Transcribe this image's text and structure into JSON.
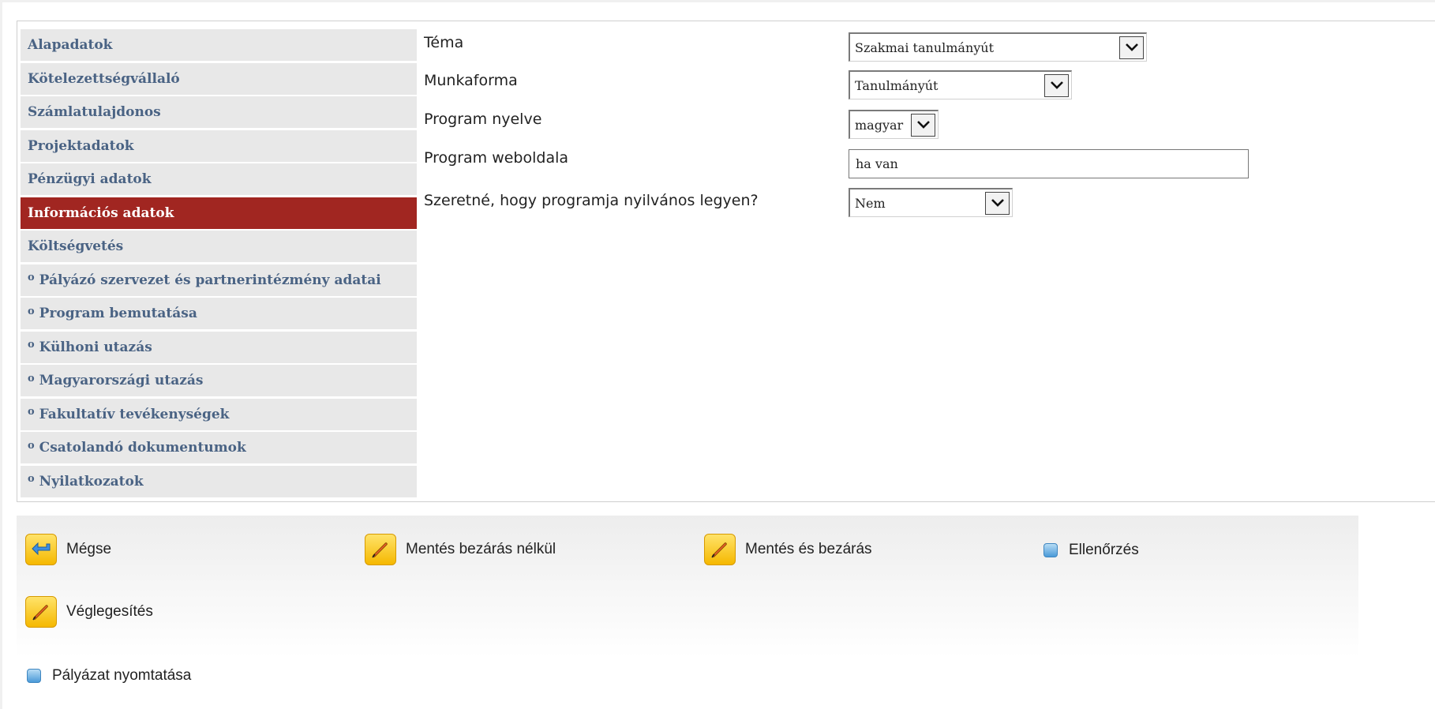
{
  "sidebar": {
    "items": [
      {
        "label": "Alapadatok",
        "bullet": ""
      },
      {
        "label": "Kötelezettségvállaló",
        "bullet": ""
      },
      {
        "label": "Számlatulajdonos",
        "bullet": ""
      },
      {
        "label": "Projektadatok",
        "bullet": ""
      },
      {
        "label": "Pénzügyi adatok",
        "bullet": ""
      },
      {
        "label": "Információs adatok",
        "bullet": ""
      },
      {
        "label": "Költségvetés",
        "bullet": ""
      },
      {
        "label": "Pályázó szervezet és partnerintézmény adatai",
        "bullet": "o"
      },
      {
        "label": "Program bemutatása",
        "bullet": "o"
      },
      {
        "label": "Külhoni utazás",
        "bullet": "o"
      },
      {
        "label": "Magyarországi utazás",
        "bullet": "o"
      },
      {
        "label": "Fakultatív tevékenységek",
        "bullet": "o"
      },
      {
        "label": "Csatolandó dokumentumok",
        "bullet": "o"
      },
      {
        "label": "Nyilatkozatok",
        "bullet": "o"
      }
    ],
    "active_label": "Információs adatok",
    "active_color": "#a12621"
  },
  "form": {
    "tema": {
      "label": "Téma",
      "value": "Szakmai tanulmányút"
    },
    "munkaforma": {
      "label": "Munkaforma",
      "value": "Tanulmányút"
    },
    "nyelv": {
      "label": "Program nyelve",
      "value": "magyar"
    },
    "weboldal": {
      "label": "Program weboldala",
      "value": "ha van"
    },
    "nyilvanos": {
      "label": "Szeretné, hogy programja nyilvános legyen?",
      "value": "Nem"
    }
  },
  "actions": {
    "megse": "Mégse",
    "mentes_bezaras_nelkul": "Mentés bezárás nélkül",
    "mentes_es_bezaras": "Mentés és bezárás",
    "ellenorzes": "Ellenőrzés",
    "veglegesites": "Véglegesítés",
    "nyomtatas": "Pályázat nyomtatása"
  },
  "icons": {
    "back": "arrow-back-icon",
    "edit": "pencil-icon",
    "small": "square-icon"
  }
}
